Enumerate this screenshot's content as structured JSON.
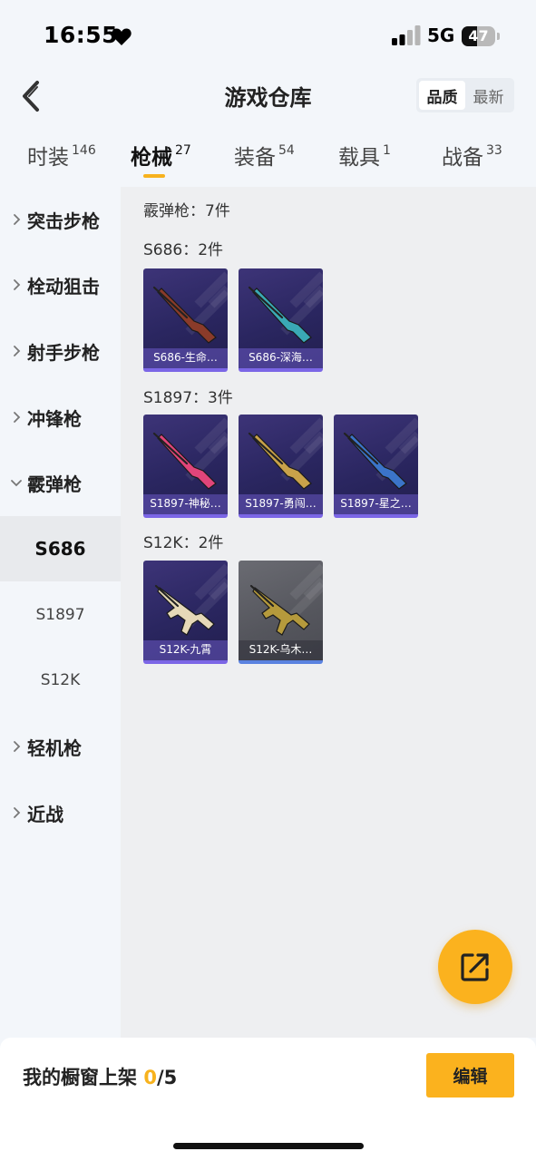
{
  "status_bar": {
    "time": "16:55",
    "network": "5G",
    "battery": "47",
    "battery_level": 0.47
  },
  "header": {
    "title": "游戏仓库",
    "sort_options": [
      "品质",
      "最新"
    ],
    "sort_selected": "品质"
  },
  "tabs": [
    {
      "label": "时装",
      "count": "146",
      "active": false
    },
    {
      "label": "枪械",
      "count": "27",
      "active": true
    },
    {
      "label": "装备",
      "count": "54",
      "active": false
    },
    {
      "label": "载具",
      "count": "1",
      "active": false
    },
    {
      "label": "战备",
      "count": "33",
      "active": false
    }
  ],
  "sidebar": {
    "categories": [
      {
        "label": "突击步枪",
        "expanded": false
      },
      {
        "label": "栓动狙击",
        "expanded": false
      },
      {
        "label": "射手步枪",
        "expanded": false
      },
      {
        "label": "冲锋枪",
        "expanded": false
      },
      {
        "label": "霰弹枪",
        "expanded": true
      },
      {
        "label": "轻机枪",
        "expanded": false
      },
      {
        "label": "近战",
        "expanded": false
      }
    ],
    "subitems": [
      {
        "label": "S686",
        "active": true
      },
      {
        "label": "S1897",
        "active": false
      },
      {
        "label": "S12K",
        "active": false
      }
    ]
  },
  "content": {
    "category_summary": "霰弹枪：7件",
    "groups": [
      {
        "title": "S686：2件",
        "items": [
          {
            "name": "S686-生命…",
            "rarity": "purple",
            "color": "#8a3b2a"
          },
          {
            "name": "S686-深海…",
            "rarity": "purple",
            "color": "#3aa9b5"
          }
        ]
      },
      {
        "title": "S1897：3件",
        "items": [
          {
            "name": "S1897-神秘…",
            "rarity": "purple",
            "color": "#e0457a"
          },
          {
            "name": "S1897-勇闯…",
            "rarity": "purple",
            "color": "#c9a24a"
          },
          {
            "name": "S1897-星之…",
            "rarity": "purple",
            "color": "#3b74c9"
          }
        ]
      },
      {
        "title": "S12K：2件",
        "items": [
          {
            "name": "S12K-九霄",
            "rarity": "purple",
            "color": "#e6d9b8"
          },
          {
            "name": "S12K-乌木…",
            "rarity": "grey",
            "color": "#b59a3c"
          }
        ]
      }
    ]
  },
  "bottom_bar": {
    "showcase_label": "我的橱窗上架",
    "showcase_count": "0",
    "showcase_total": "/5",
    "edit_label": "编辑"
  },
  "colors": {
    "accent": "#fbb21e",
    "purple_rarity": "#7b66e6",
    "grey_rarity_line": "#5a82e0"
  }
}
